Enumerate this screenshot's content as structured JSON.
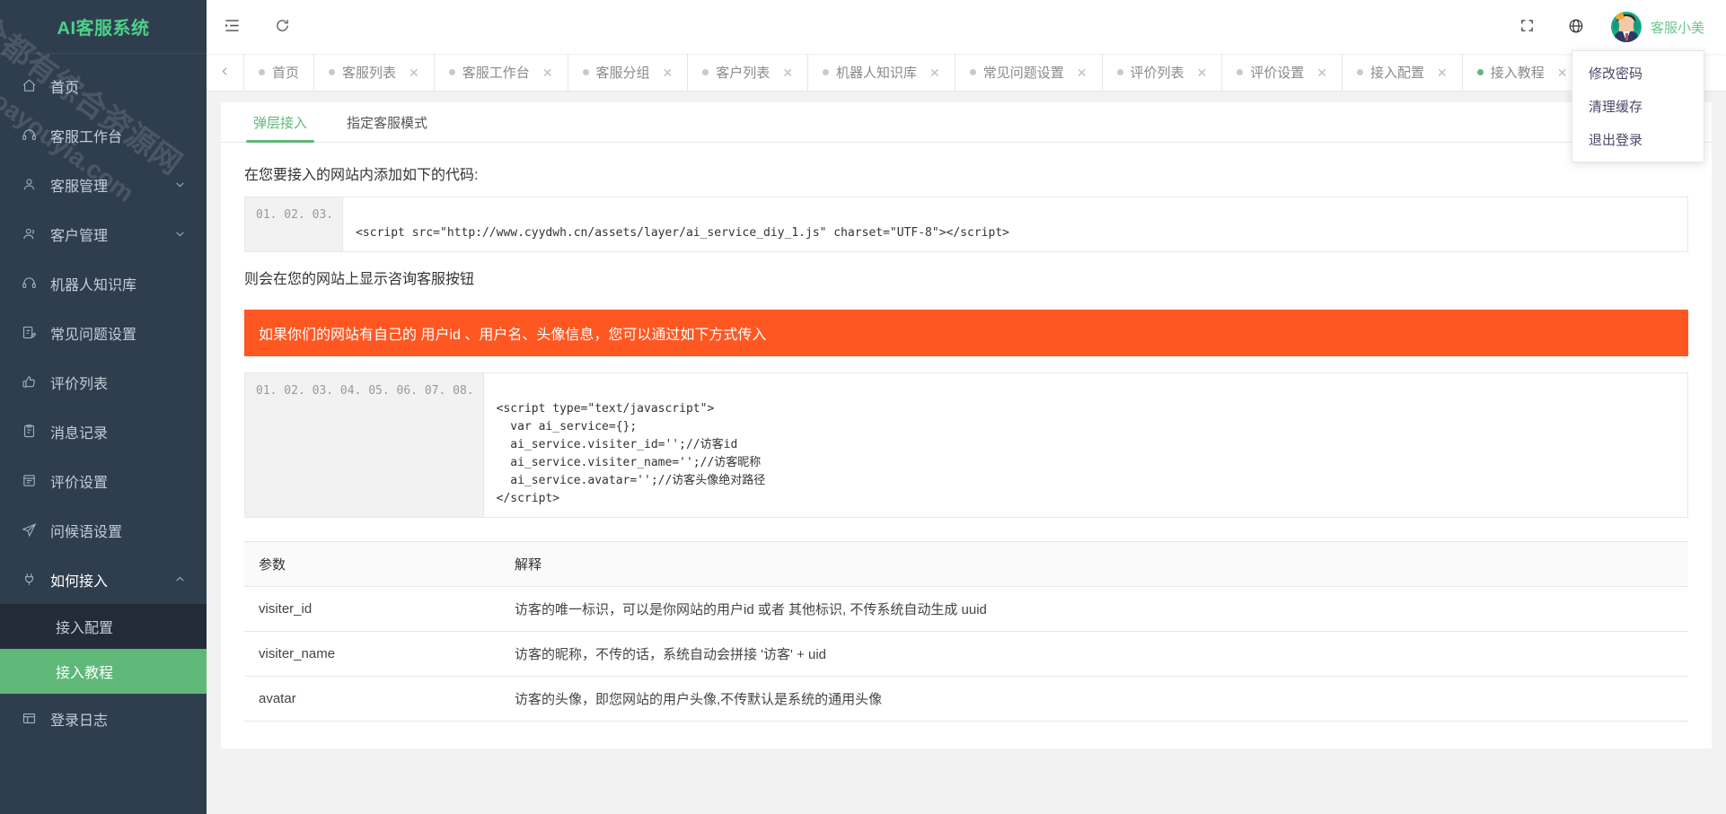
{
  "app": {
    "title": "AI客服系统"
  },
  "watermark": {
    "line1": "全都有综合资源网",
    "line2": "doayouyia.com"
  },
  "sidebar": {
    "items": [
      {
        "label": "首页",
        "icon": "home-icon",
        "expandable": false
      },
      {
        "label": "客服工作台",
        "icon": "headset-icon",
        "expandable": false
      },
      {
        "label": "客服管理",
        "icon": "user-icon",
        "expandable": true,
        "expanded": false
      },
      {
        "label": "客户管理",
        "icon": "users-icon",
        "expandable": true,
        "expanded": false
      },
      {
        "label": "机器人知识库",
        "icon": "robot-icon",
        "expandable": false
      },
      {
        "label": "常见问题设置",
        "icon": "faq-icon",
        "expandable": false
      },
      {
        "label": "评价列表",
        "icon": "thumbs-up-icon",
        "expandable": false
      },
      {
        "label": "消息记录",
        "icon": "message-log-icon",
        "expandable": false
      },
      {
        "label": "评价设置",
        "icon": "rate-settings-icon",
        "expandable": false
      },
      {
        "label": "问候语设置",
        "icon": "send-icon",
        "expandable": false
      },
      {
        "label": "如何接入",
        "icon": "plug-icon",
        "expandable": true,
        "expanded": true
      },
      {
        "label": "登录日志",
        "icon": "log-icon",
        "expandable": false
      }
    ],
    "subitems": [
      {
        "label": "接入配置",
        "active": false
      },
      {
        "label": "接入教程",
        "active": true
      }
    ]
  },
  "header": {
    "collapse_icon": "menu-collapse-icon",
    "refresh_icon": "refresh-icon",
    "fullscreen_icon": "fullscreen-icon",
    "language_icon": "globe-icon",
    "user_name": "客服小美",
    "user_name_color": "#6cc58c",
    "dropdown": [
      {
        "label": "修改密码"
      },
      {
        "label": "清理缓存"
      },
      {
        "label": "退出登录"
      }
    ]
  },
  "tabbar": {
    "back_icon": "chevron-left-icon",
    "tabs": [
      {
        "label": "首页",
        "closable": false,
        "active": false
      },
      {
        "label": "客服列表",
        "closable": true,
        "active": false
      },
      {
        "label": "客服工作台",
        "closable": true,
        "active": false
      },
      {
        "label": "客服分组",
        "closable": true,
        "active": false
      },
      {
        "label": "客户列表",
        "closable": true,
        "active": false
      },
      {
        "label": "机器人知识库",
        "closable": true,
        "active": false
      },
      {
        "label": "常见问题设置",
        "closable": true,
        "active": false
      },
      {
        "label": "评价列表",
        "closable": true,
        "active": false
      },
      {
        "label": "评价设置",
        "closable": true,
        "active": false
      },
      {
        "label": "接入配置",
        "closable": true,
        "active": false
      },
      {
        "label": "接入教程",
        "closable": true,
        "active": true
      }
    ]
  },
  "page": {
    "subtabs": [
      {
        "label": "弹层接入",
        "active": true
      },
      {
        "label": "指定客服模式",
        "active": false
      }
    ],
    "lead_text": "在您要接入的网站内添加如下的代码:",
    "code1": {
      "line_numbers": "01.\n02.\n03.",
      "code": "\n<script src=\"http://www.cyydwh.cn/assets/layer/ai_service_diy_1.js\" charset=\"UTF-8\"></script>\n"
    },
    "after_code_text": "则会在您的网站上显示咨询客服按钮",
    "banner_text": "如果你们的网站有自己的 用户id 、用户名、头像信息，您可以通过如下方式传入",
    "banner_color": "#FF5722",
    "code2": {
      "line_numbers": "01.\n02.\n03.\n04.\n05.\n06.\n07.\n08.",
      "code": "\n<script type=\"text/javascript\">\n  var ai_service={};\n  ai_service.visiter_id='';//访客id\n  ai_service.visiter_name='';//访客昵称\n  ai_service.avatar='';//访客头像绝对路径\n</script>\n"
    },
    "table": {
      "headers": [
        "参数",
        "解释"
      ],
      "rows": [
        [
          "visiter_id",
          "访客的唯一标识，可以是你网站的用户id 或者 其他标识, 不传系统自动生成 uuid"
        ],
        [
          "visiter_name",
          "访客的昵称，不传的话，系统自动会拼接 '访客' + uid"
        ],
        [
          "avatar",
          "访客的头像，即您网站的用户头像,不传默认是系统的通用头像"
        ]
      ]
    }
  },
  "theme": {
    "sidebar_bg": "#2f3e4e",
    "sub_bg": "#222b37",
    "accent_green": "#5FB878",
    "logo_green": "#4ecf8a"
  }
}
